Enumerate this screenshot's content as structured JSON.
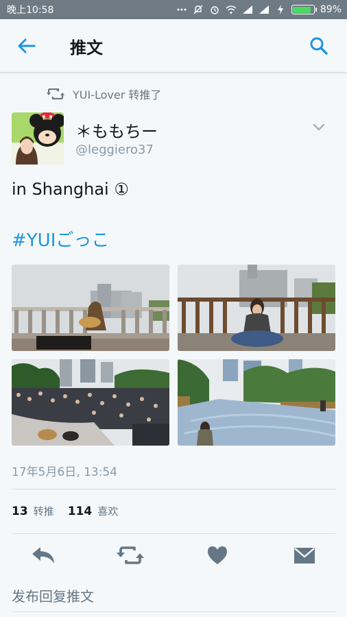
{
  "status_bar": {
    "time": "晚上10:58",
    "battery": "89%",
    "battery_level": 0.89,
    "accent_color": "#4cd964"
  },
  "app_bar": {
    "title": "推文",
    "back_icon": "arrow-left-icon",
    "search_icon": "search-icon",
    "accent_color": "#1b95e0"
  },
  "retweet_context": {
    "icon": "retweet-icon",
    "text": "YUI-Lover 转推了"
  },
  "tweet": {
    "author_name": "＊ももちー",
    "author_handle": "@leggiero37",
    "text": "in Shanghai ①",
    "hashtag": "#YUIごっこ",
    "timestamp": "17年5月6日, 13:54",
    "retweet_count": "13",
    "retweet_label": "转推",
    "like_count": "114",
    "like_label": "喜欢"
  },
  "actions": {
    "reply_icon": "reply-icon",
    "retweet_icon": "retweet-icon",
    "like_icon": "heart-icon",
    "dm_icon": "envelope-icon"
  },
  "reply_box": {
    "placeholder": "发布回复推文"
  }
}
